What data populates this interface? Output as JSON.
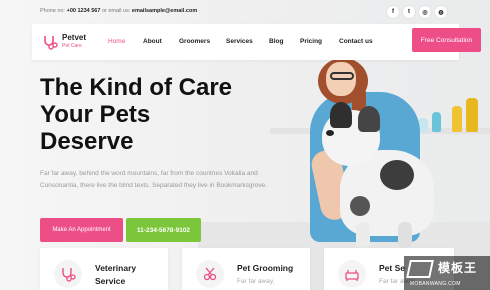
{
  "topbar": {
    "phone_prefix": "Phone no:",
    "phone": "+00 1234 567",
    "email_prefix": "or email us:",
    "email": "emailsample@email.com",
    "social": [
      {
        "icon": "facebook-icon",
        "glyph": "f"
      },
      {
        "icon": "twitter-icon",
        "glyph": "t"
      },
      {
        "icon": "instagram-icon",
        "glyph": "◎"
      },
      {
        "icon": "dribbble-icon",
        "glyph": "◍"
      }
    ]
  },
  "nav": {
    "logo_title": "Petvet",
    "logo_sub": "Pet Care",
    "items": [
      "Home",
      "About",
      "Groomers",
      "Services",
      "Blog",
      "Pricing",
      "Contact us"
    ],
    "active": "Home",
    "cta": "Free Consultation"
  },
  "hero": {
    "title_lines": [
      "The Kind of Care",
      "Your Pets",
      "Deserve"
    ],
    "desc": "Far far away, behind the word mountains, far from the countries Vokalia and Consonantia, there live the blind texts. Separated they live in Bookmarksgrove.",
    "btn_appointment": "Make An Appointment",
    "btn_phone": "11-234-5678-9102"
  },
  "services": [
    {
      "title_line1": "Veterinary",
      "title_line2": "Service",
      "text": "",
      "icon": "stethoscope-icon"
    },
    {
      "title_line1": "Pet Grooming",
      "title_line2": "",
      "text": "Far far away,",
      "icon": "grooming-icon"
    },
    {
      "title_line1": "Pet Se",
      "title_line2": "",
      "text": "Far far away,",
      "icon": "pet-sitting-icon"
    }
  ],
  "watermark": {
    "cn": "模板王",
    "en": "MOBANWANG.COM"
  },
  "colors": {
    "accent": "#ec4e85",
    "green": "#7cc63c"
  }
}
